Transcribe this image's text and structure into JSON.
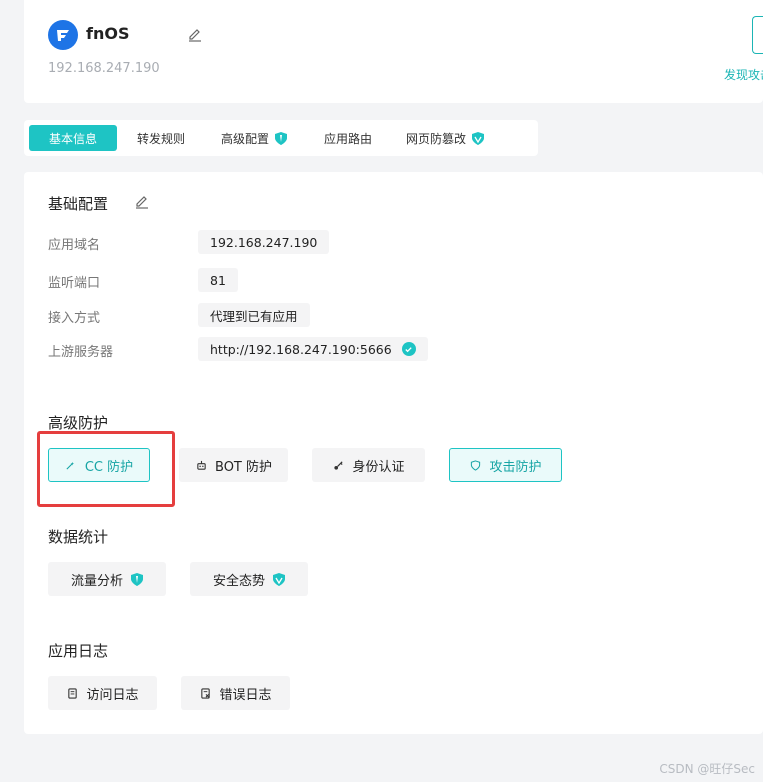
{
  "header": {
    "app_name": "fnOS",
    "ip": "192.168.247.190",
    "right_link": "发现攻击"
  },
  "tabs": [
    {
      "label": "基本信息",
      "active": true,
      "badge": false
    },
    {
      "label": "转发规则",
      "active": false,
      "badge": false
    },
    {
      "label": "高级配置",
      "active": false,
      "badge": true
    },
    {
      "label": "应用路由",
      "active": false,
      "badge": false
    },
    {
      "label": "网页防篡改",
      "active": false,
      "badge": true
    }
  ],
  "basic": {
    "title": "基础配置",
    "rows": [
      {
        "label": "应用域名",
        "value": "192.168.247.190"
      },
      {
        "label": "监听端口",
        "value": "81"
      },
      {
        "label": "接入方式",
        "value": "代理到已有应用"
      },
      {
        "label": "上游服务器",
        "value": "http://192.168.247.190:5666"
      }
    ]
  },
  "advanced": {
    "title": "高级防护",
    "buttons": [
      "CC 防护",
      "BOT 防护",
      "身份认证",
      "攻击防护"
    ]
  },
  "stats": {
    "title": "数据统计",
    "buttons": [
      "流量分析",
      "安全态势"
    ]
  },
  "logs": {
    "title": "应用日志",
    "buttons": [
      "访问日志",
      "错误日志"
    ]
  },
  "colors": {
    "accent": "#1ec4c4",
    "highlight": "#e53e3e",
    "logo": "#1e74e6"
  },
  "watermark": "CSDN @旺仔Sec"
}
